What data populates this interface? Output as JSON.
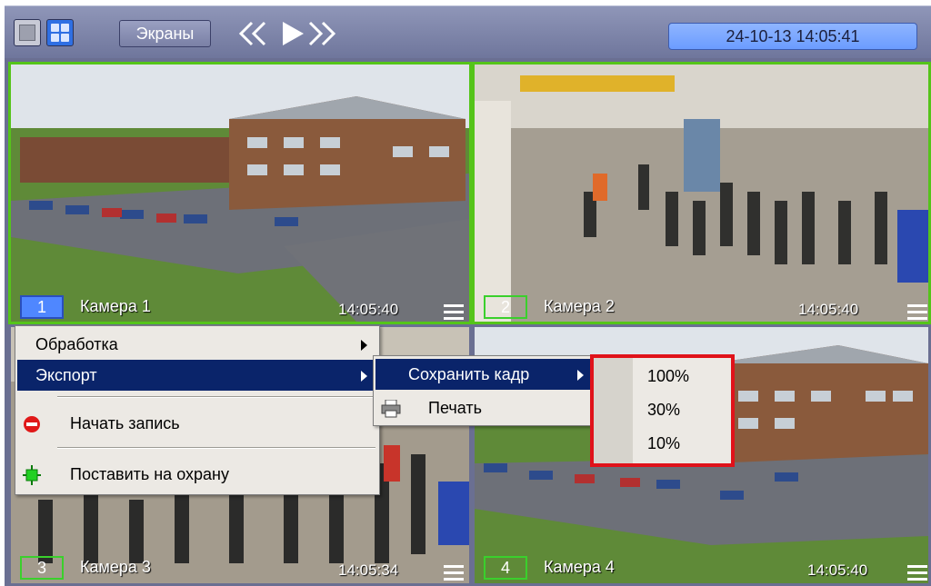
{
  "toolbar": {
    "screens_label": "Экраны",
    "clock": "24-10-13  14:05:41"
  },
  "icons": [
    "single-view-icon",
    "grid-view-icon",
    "rewind-icon",
    "play-icon",
    "fast-forward-icon",
    "menu-icon",
    "record-icon",
    "arm-icon",
    "printer-icon"
  ],
  "cameras": [
    {
      "num": "1",
      "name": "Камера 1",
      "time": "14:05:40"
    },
    {
      "num": "2",
      "name": "Камера 2",
      "time": "14:05:40"
    },
    {
      "num": "3",
      "name": "Камера 3",
      "time": "14:05:34"
    },
    {
      "num": "4",
      "name": "Камера 4",
      "time": "14:05:40"
    }
  ],
  "context_menu": {
    "items": [
      "Обработка",
      "Экспорт",
      "Начать запись",
      "Поставить на охрану"
    ]
  },
  "export_menu": {
    "items": [
      "Сохранить кадр",
      "Печать"
    ]
  },
  "save_menu": {
    "items": [
      "100%",
      "30%",
      "10%"
    ]
  },
  "colors": {
    "toolbar": "#7a80a6",
    "active_frame": "#55c41a",
    "menu_highlight": "#0a246a",
    "callout": "#e0121a",
    "clock_bg": "#6b9cff"
  }
}
